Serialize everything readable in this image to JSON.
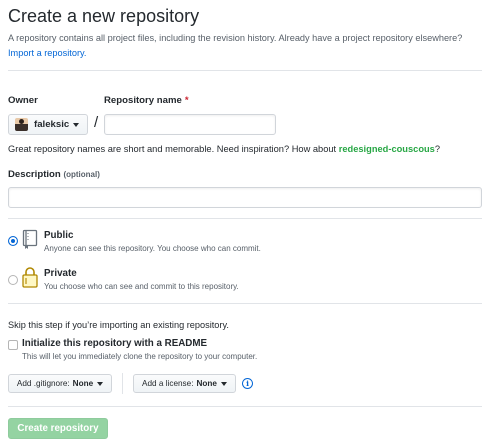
{
  "header": {
    "title": "Create a new repository",
    "subtitle": "A repository contains all project files, including the revision history. Already have a project repository elsewhere?",
    "import_link": "Import a repository."
  },
  "owner": {
    "label": "Owner",
    "value": "faleksic"
  },
  "repo_name": {
    "label": "Repository name",
    "required_mark": "*",
    "value": "",
    "separator": "/"
  },
  "name_hint": {
    "text": "Great repository names are short and memorable. Need inspiration? How about",
    "suggestion": "redesigned-couscous",
    "suffix": "?"
  },
  "description": {
    "label": "Description",
    "optional": "(optional)",
    "value": ""
  },
  "visibility": {
    "selected": "public",
    "public": {
      "title": "Public",
      "desc": "Anyone can see this repository. You choose who can commit.",
      "icon": "repo-icon"
    },
    "private": {
      "title": "Private",
      "desc": "You choose who can see and commit to this repository.",
      "icon": "lock-icon"
    }
  },
  "init": {
    "skip_note": "Skip this step if you’re importing an existing repository.",
    "readme_title": "Initialize this repository with a README",
    "readme_desc": "This will let you immediately clone the repository to your computer.",
    "readme_checked": false
  },
  "gitignore": {
    "label": "Add .gitignore:",
    "value": "None"
  },
  "license": {
    "label": "Add a license:",
    "value": "None"
  },
  "info_icon": "i",
  "submit": {
    "label": "Create repository"
  },
  "colors": {
    "link": "#0366d6",
    "suggestion": "#28a745",
    "required": "#cb2431",
    "submit_disabled": "#94d3a2"
  }
}
